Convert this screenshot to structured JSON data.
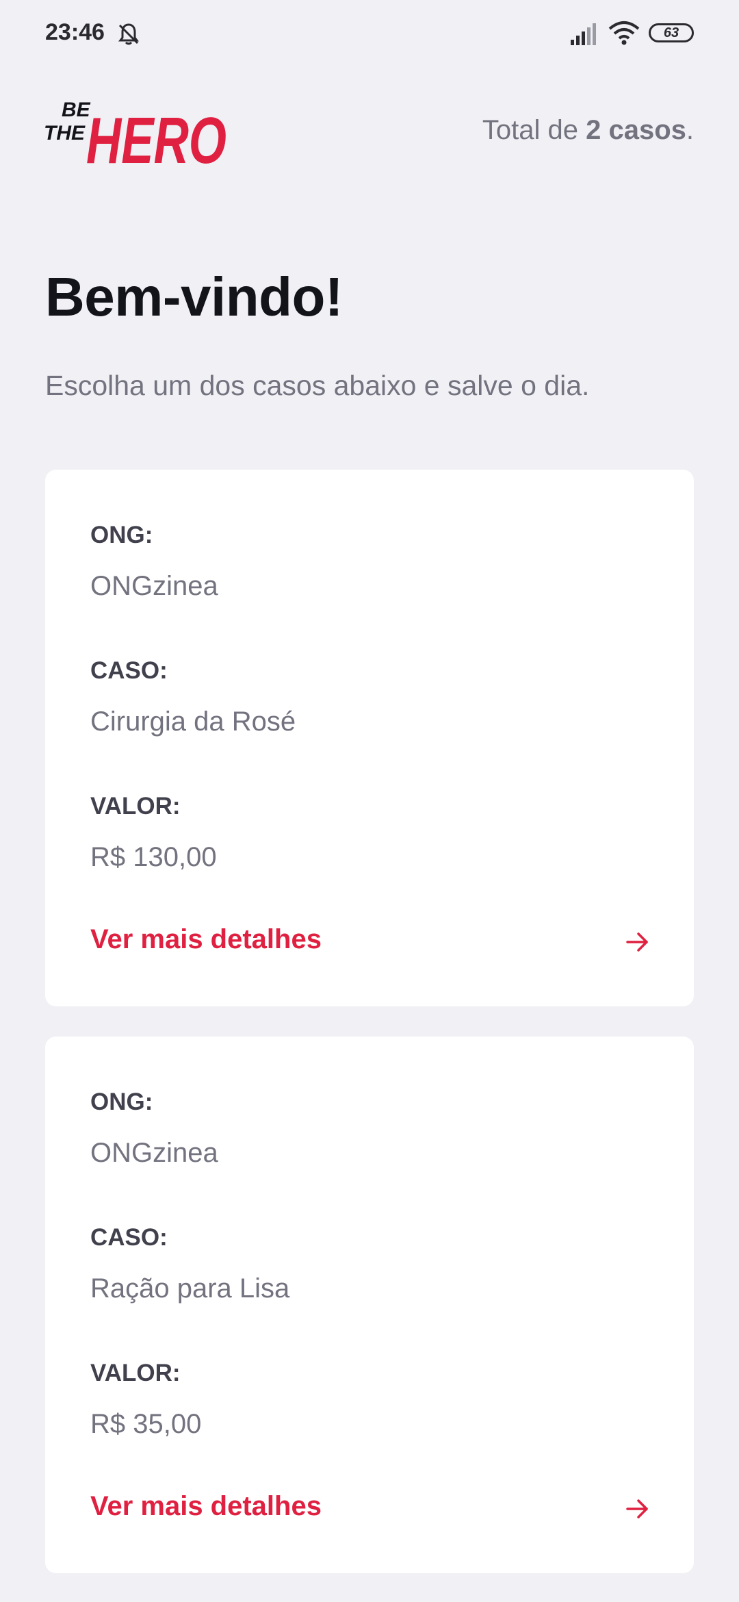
{
  "status_bar": {
    "time": "23:46",
    "battery": "63"
  },
  "header": {
    "logo_text_small": "BE THE",
    "logo_text_big": "HERO",
    "total_prefix": "Total de ",
    "total_count": "2 casos",
    "total_suffix": "."
  },
  "title": "Bem-vindo!",
  "description": "Escolha um dos casos abaixo e salve o dia.",
  "incidents": [
    {
      "ong_label": "ONG:",
      "ong_value": "ONGzinea",
      "caso_label": "CASO:",
      "caso_value": "Cirurgia da Rosé",
      "valor_label": "VALOR:",
      "valor_value": "R$ 130,00",
      "details_label": "Ver mais detalhes"
    },
    {
      "ong_label": "ONG:",
      "ong_value": "ONGzinea",
      "caso_label": "CASO:",
      "caso_value": "Ração para Lisa",
      "valor_label": "VALOR:",
      "valor_value": "R$ 35,00",
      "details_label": "Ver mais detalhes"
    }
  ],
  "colors": {
    "accent": "#e02041",
    "background": "#f0f0f5",
    "card": "#ffffff",
    "title": "#13131a",
    "label": "#41414d",
    "muted": "#737380"
  },
  "icons": {
    "bell": "bell-off-icon",
    "signal": "signal-icon",
    "wifi": "wifi-icon",
    "arrow": "arrow-right-icon"
  }
}
